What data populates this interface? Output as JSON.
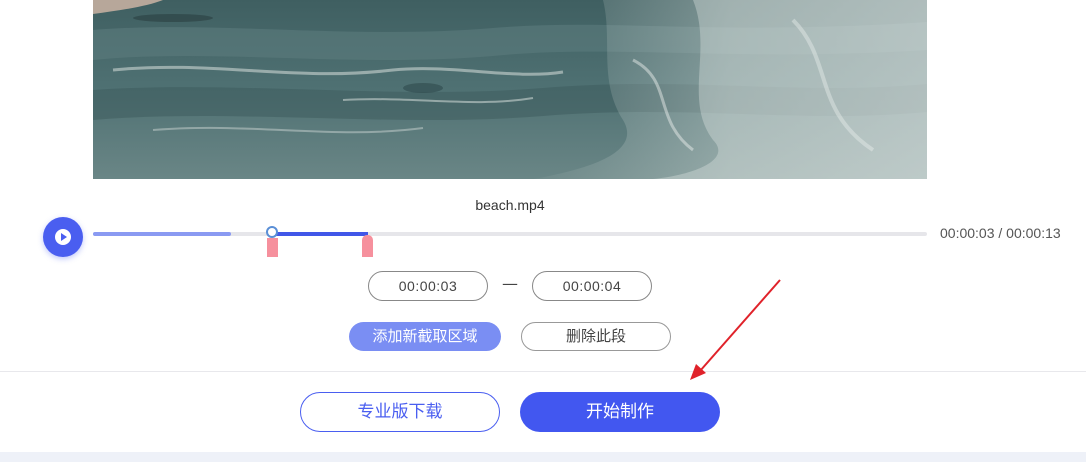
{
  "video": {
    "filename": "beach.mp4"
  },
  "player": {
    "current_time": "00:00:03",
    "total_time": "00:00:13",
    "time_readout": "00:00:03 / 00:00:13",
    "progress_fraction": 0.23,
    "selection_start_fraction": 0.23,
    "selection_end_fraction": 0.33
  },
  "clip": {
    "start": "00:00:03",
    "separator": "—",
    "end": "00:00:04"
  },
  "actions": {
    "add_region": "添加新截取区域",
    "delete_segment": "删除此段"
  },
  "footer": {
    "pro_download": "专业版下载",
    "start_making": "开始制作"
  },
  "colors": {
    "accent": "#4257f0",
    "accent_light": "#7a8ef3",
    "marker": "#f6909d",
    "annotation_arrow": "#e0222a"
  },
  "icons": {
    "play": "play-icon"
  }
}
